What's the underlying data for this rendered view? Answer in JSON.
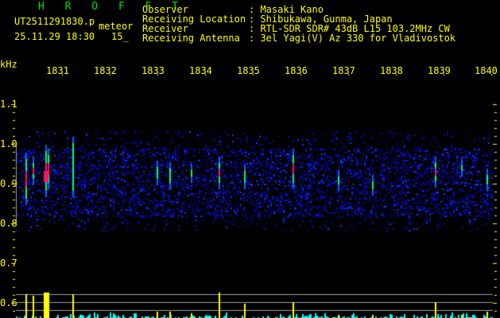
{
  "header": {
    "app_title": "H R O F F T",
    "filename": "UT2511291830.png",
    "mode": "meteor",
    "datetime": "25.11.29 18:30",
    "interval": "15_",
    "fields": [
      {
        "label": "Observer",
        "value": ": Masaki Kano"
      },
      {
        "label": "Receiving Location",
        "value": ": Shibukawa, Gunma, Japan"
      },
      {
        "label": "Receiver",
        "value": ": RTL-SDR SDR# 43dB L15 103.2MHz CW"
      },
      {
        "label": "Receiving Antenna",
        "value": ": 3el Yagi(V) Az 330 for Vladivostok"
      }
    ]
  },
  "axis": {
    "y_unit": "kHz",
    "y_ticks": [
      "1.1",
      "1.0",
      "0.9",
      "0.8",
      "0.7",
      "0.6"
    ],
    "x_ticks": [
      "1831",
      "1832",
      "1833",
      "1834",
      "1835",
      "1836",
      "1837",
      "1838",
      "1839",
      "1840"
    ]
  },
  "colors": {
    "text": "#ffff00",
    "title": "#00e000",
    "noise": "#0010c0",
    "echo_strong": "#ff1060",
    "echo_mid": "#00ff60",
    "level_bar": "#ffff00",
    "noise_bar": "#00ffff",
    "grid": "#a0a0a0"
  }
}
